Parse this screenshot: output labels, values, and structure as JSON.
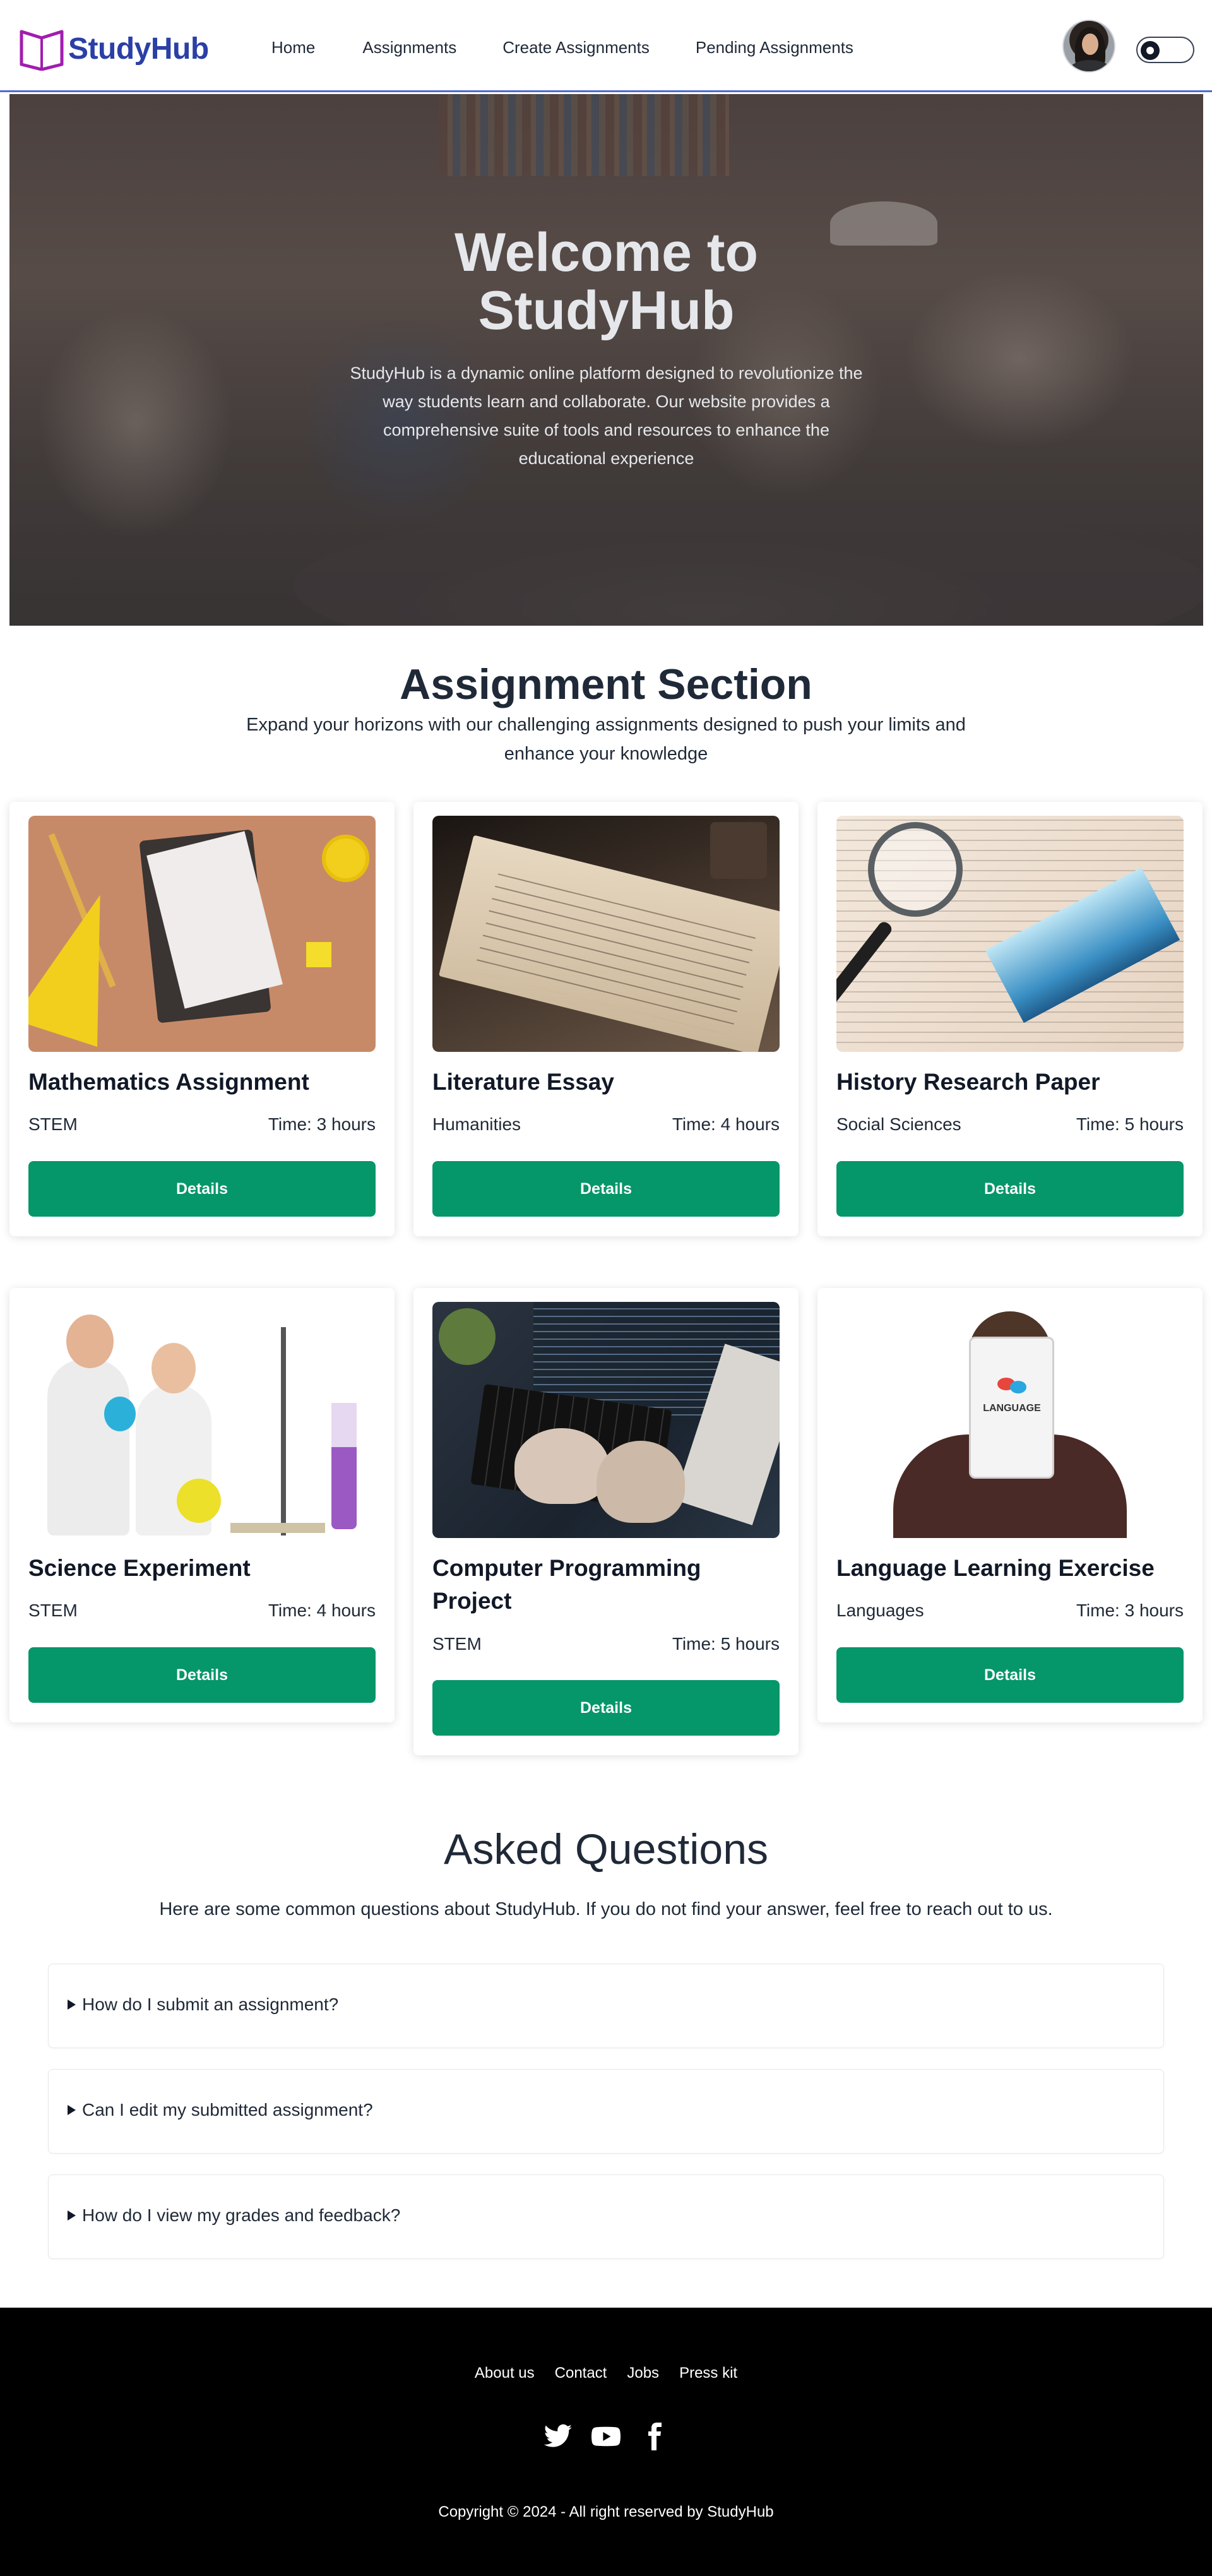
{
  "brand": {
    "name": "StudyHub",
    "color": "#2b3fa6",
    "mark_color": "#a21caf"
  },
  "nav": {
    "links": [
      "Home",
      "Assignments",
      "Create Assignments",
      "Pending Assignments"
    ]
  },
  "theme_toggle": {
    "icon": "sun-icon",
    "state": "light"
  },
  "hero": {
    "title": "Welcome to StudyHub",
    "description": "StudyHub is a dynamic online platform designed to revolutionize the way students learn and collaborate. Our website provides a comprehensive suite of tools and resources to enhance the educational experience"
  },
  "assignments": {
    "title": "Assignment Section",
    "subtitle": "Expand your horizons with our challenging assignments designed to push your limits and enhance your knowledge",
    "button_label": "Details",
    "button_color": "#059669",
    "cards": [
      {
        "title": "Mathematics Assignment",
        "category": "STEM",
        "time": "Time: 3 hours"
      },
      {
        "title": "Literature Essay",
        "category": "Humanities",
        "time": "Time: 4 hours"
      },
      {
        "title": "History Research Paper",
        "category": "Social Sciences",
        "time": "Time: 5 hours"
      },
      {
        "title": "Science Experiment",
        "category": "STEM",
        "time": "Time: 4 hours"
      },
      {
        "title": "Computer Programming Project",
        "category": "STEM",
        "time": "Time: 5 hours"
      },
      {
        "title": "Language Learning Exercise",
        "category": "Languages",
        "time": "Time: 3 hours"
      }
    ],
    "image_text_language": "LANGUAGE"
  },
  "faq": {
    "title": "Asked Questions",
    "subtitle": "Here are some common questions about StudyHub. If you do not find your answer, feel free to reach out to us.",
    "items": [
      "How do I submit an assignment?",
      "Can I edit my submitted assignment?",
      "How do I view my grades and feedback?"
    ]
  },
  "footer": {
    "links": [
      "About us",
      "Contact",
      "Jobs",
      "Press kit"
    ],
    "social": [
      "twitter-icon",
      "youtube-icon",
      "facebook-icon"
    ],
    "copyright": "Copyright © 2024 - All right reserved by StudyHub"
  }
}
